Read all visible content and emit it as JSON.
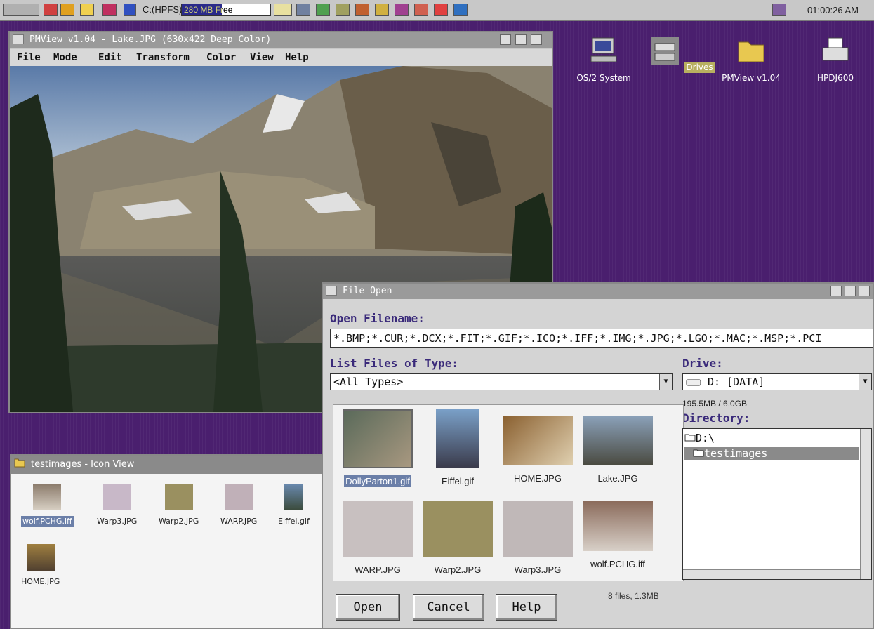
{
  "taskbar": {
    "drive": "C:(HPFS)",
    "free_space": "280 MB Free",
    "clock": "01:00:26 AM"
  },
  "desktop": {
    "icons": [
      {
        "label": "OS/2 System",
        "icon": "computer-icon",
        "selected": false
      },
      {
        "label": "Drives",
        "icon": "drives-icon",
        "selected": true
      },
      {
        "label": "PMView v1.04",
        "icon": "folder-icon",
        "selected": false
      },
      {
        "label": "HPDJ600",
        "icon": "printer-icon",
        "selected": false
      }
    ]
  },
  "pmview": {
    "title": "PMView v1.04 - Lake.JPG (630x422 Deep Color)",
    "menu": [
      "File",
      "Mode",
      "Edit",
      "Transform",
      "Color",
      "View",
      "Help"
    ]
  },
  "iconview": {
    "title": "testimages - Icon View",
    "items": [
      {
        "label": "wolf.PCHG.iff",
        "selected": true
      },
      {
        "label": "Warp3.JPG",
        "selected": false
      },
      {
        "label": "Warp2.JPG",
        "selected": false
      },
      {
        "label": "WARP.JPG",
        "selected": false
      },
      {
        "label": "Eiffel.gif",
        "selected": false
      },
      {
        "label": "HOME.JPG",
        "selected": false
      }
    ]
  },
  "fileopen": {
    "title": "File Open",
    "filename_label": "Open Filename:",
    "filename_value": "*.BMP;*.CUR;*.DCX;*.FIT;*.GIF;*.ICO;*.IFF;*.IMG;*.JPG;*.LGO;*.MAC;*.MSP;*.PCI",
    "type_label": "List Files of Type:",
    "type_value": "<All Types>",
    "drive_label": "Drive:",
    "drive_value": "D: [DATA]",
    "drive_space": "195.5MB / 6.0GB",
    "directory_label": "Directory:",
    "directories": [
      {
        "label": "D:\\",
        "selected": false
      },
      {
        "label": "testimages",
        "selected": true
      }
    ],
    "files": [
      {
        "label": "DollyParton1.gif",
        "selected": true
      },
      {
        "label": "Eiffel.gif",
        "selected": false
      },
      {
        "label": "HOME.JPG",
        "selected": false
      },
      {
        "label": "Lake.JPG",
        "selected": false
      },
      {
        "label": "WARP.JPG",
        "selected": false
      },
      {
        "label": "Warp2.JPG",
        "selected": false
      },
      {
        "label": "Warp3.JPG",
        "selected": false
      },
      {
        "label": "wolf.PCHG.iff",
        "selected": false
      }
    ],
    "stats": "8 files, 1.3MB",
    "open_label": "Open",
    "cancel_label": "Cancel",
    "help_label": "Help"
  },
  "colors": {
    "desktop": "#4a1f6e",
    "titlebar": "#9a9a9a",
    "label_accent": "#3a2a7a",
    "selection": "#6b7fa8"
  }
}
